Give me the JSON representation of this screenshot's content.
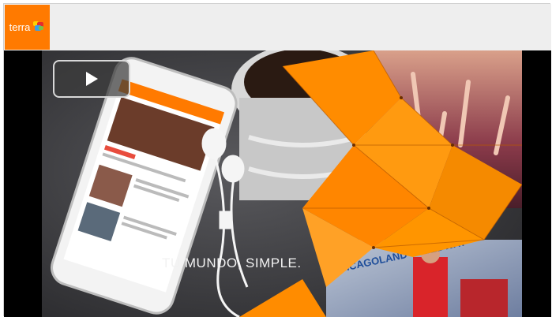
{
  "brand": {
    "name": "terra",
    "color": "#ff7a00"
  },
  "video": {
    "caption": "TU MUNDO, SIMPLE.",
    "play_icon": "play-icon",
    "accent": "#ff8c00",
    "billboard_text": "CHICAGOLAND SPEEDWAY"
  }
}
